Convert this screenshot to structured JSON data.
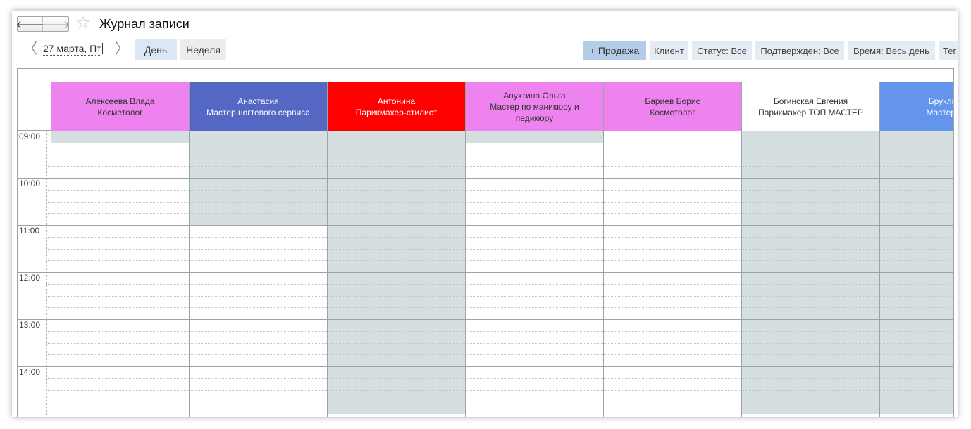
{
  "window": {
    "title": "Журнал записи"
  },
  "nav": {
    "back_glyph": "🡐",
    "forward_glyph": "🡒",
    "favorite_glyph": "☆"
  },
  "toolbar": {
    "prev_glyph": "〈",
    "next_glyph": "〉",
    "date": "27 марта, Пт",
    "day_label": "День",
    "week_label": "Неделя",
    "sale_label": "+ Продажа",
    "client_label": "Клиент",
    "status_label": "Статус: Все",
    "confirmed_label": "Подтвержден: Все",
    "time_label": "Время: Весь день",
    "extra_label": "Тег"
  },
  "times": [
    "09:00",
    "10:00",
    "11:00",
    "12:00",
    "13:00",
    "14:00"
  ],
  "staff": [
    {
      "name": "Алексеева Влада",
      "role": "Косметолог",
      "header_color": "#ee82ee",
      "text_color": "#333333",
      "unavailable_hours": 0.25
    },
    {
      "name": "Анастасия",
      "role": "Мастер ногтевого сервиса",
      "header_color": "#5468c3",
      "text_color": "#ffffff",
      "unavailable_hours": 2
    },
    {
      "name": "Антонина",
      "role": "Парикмахер-стилист",
      "header_color": "#ff0000",
      "text_color": "#ffffff",
      "unavailable_hours": 6
    },
    {
      "name": "Апухтина Ольга",
      "role": "Мастер по маникюру и педикюру",
      "header_color": "#ee82ee",
      "text_color": "#333333",
      "unavailable_hours": 0.25
    },
    {
      "name": "Бариев Борис",
      "role": "Косметолог",
      "header_color": "#ee82ee",
      "text_color": "#333333",
      "unavailable_hours": 0
    },
    {
      "name": "Богинская Евгения",
      "role": "Парикмахер ТОП МАСТЕР",
      "header_color": "#ffffff",
      "text_color": "#333333",
      "unavailable_hours": 6
    },
    {
      "name": "Бруклин А",
      "role": "Мастер уни",
      "header_color": "#6495ed",
      "text_color": "#ffffff",
      "unavailable_hours": 6
    }
  ],
  "colors": {
    "unavailable": "#d5dfdf",
    "grid_line": "#9aa2aa",
    "accent": "#b3cce8"
  }
}
